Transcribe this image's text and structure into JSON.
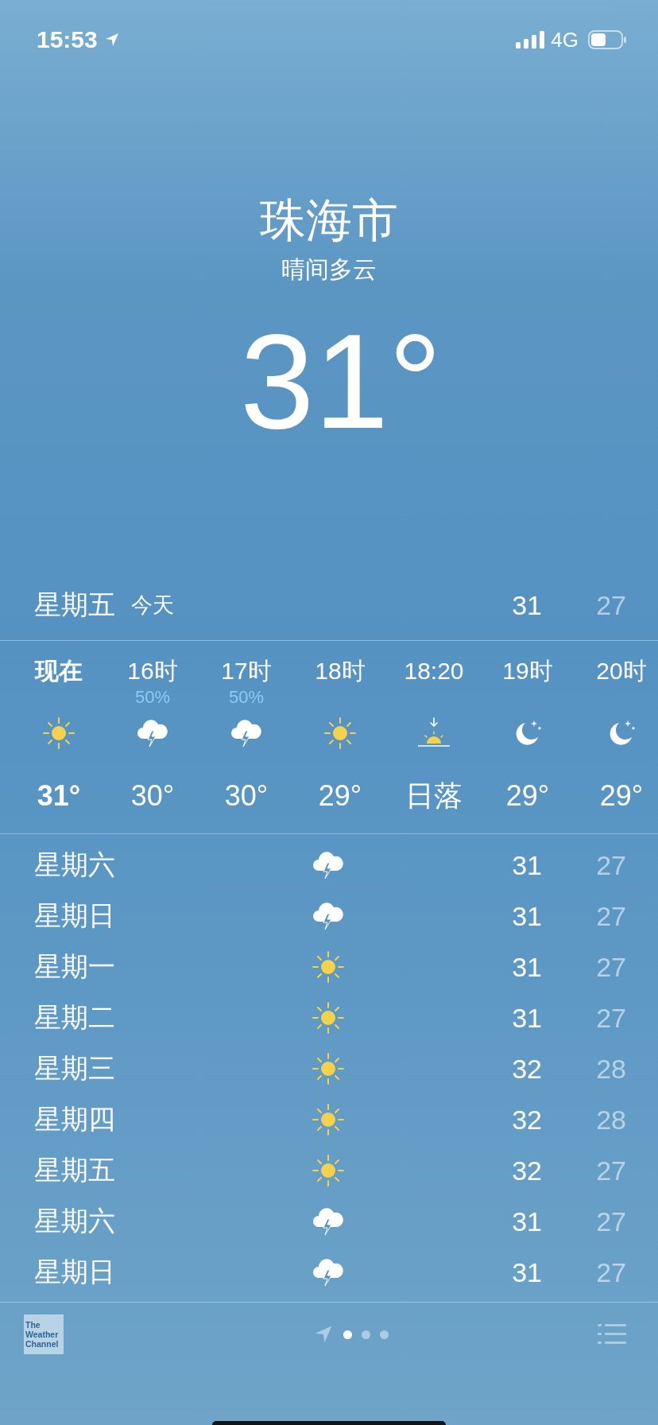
{
  "status_bar": {
    "time": "15:53",
    "network": "4G"
  },
  "location": {
    "city": "珠海市",
    "condition": "晴间多云",
    "temperature": "31°"
  },
  "today": {
    "day": "星期五",
    "label": "今天",
    "high": "31",
    "low": "27"
  },
  "hourly": [
    {
      "time": "现在",
      "current": true,
      "kind": "sun",
      "temp": "31°"
    },
    {
      "time": "16时",
      "current": false,
      "precipitation": "50%",
      "kind": "storm",
      "temp": "30°"
    },
    {
      "time": "17时",
      "current": false,
      "precipitation": "50%",
      "kind": "storm",
      "temp": "30°"
    },
    {
      "time": "18时",
      "current": false,
      "kind": "sun",
      "temp": "29°"
    },
    {
      "time": "18:20",
      "current": false,
      "kind": "sunset",
      "temp": "日落"
    },
    {
      "time": "19时",
      "current": false,
      "kind": "moon",
      "temp": "29°"
    },
    {
      "time": "20时",
      "current": false,
      "kind": "moon",
      "temp": "29°"
    }
  ],
  "daily": [
    {
      "day": "星期六",
      "kind": "storm",
      "high": "31",
      "low": "27"
    },
    {
      "day": "星期日",
      "kind": "storm",
      "high": "31",
      "low": "27"
    },
    {
      "day": "星期一",
      "kind": "sun",
      "high": "31",
      "low": "27"
    },
    {
      "day": "星期二",
      "kind": "sun",
      "high": "31",
      "low": "27"
    },
    {
      "day": "星期三",
      "kind": "sun",
      "high": "32",
      "low": "28"
    },
    {
      "day": "星期四",
      "kind": "sun",
      "high": "32",
      "low": "28"
    },
    {
      "day": "星期五",
      "kind": "sun",
      "high": "32",
      "low": "27"
    },
    {
      "day": "星期六",
      "kind": "storm",
      "high": "31",
      "low": "27"
    },
    {
      "day": "星期日",
      "kind": "storm",
      "high": "31",
      "low": "27"
    }
  ],
  "footer": {
    "logo": [
      "The",
      "Weather",
      "Channel"
    ],
    "pages": [
      {
        "selected": true
      },
      {
        "selected": false
      },
      {
        "selected": false
      }
    ]
  }
}
